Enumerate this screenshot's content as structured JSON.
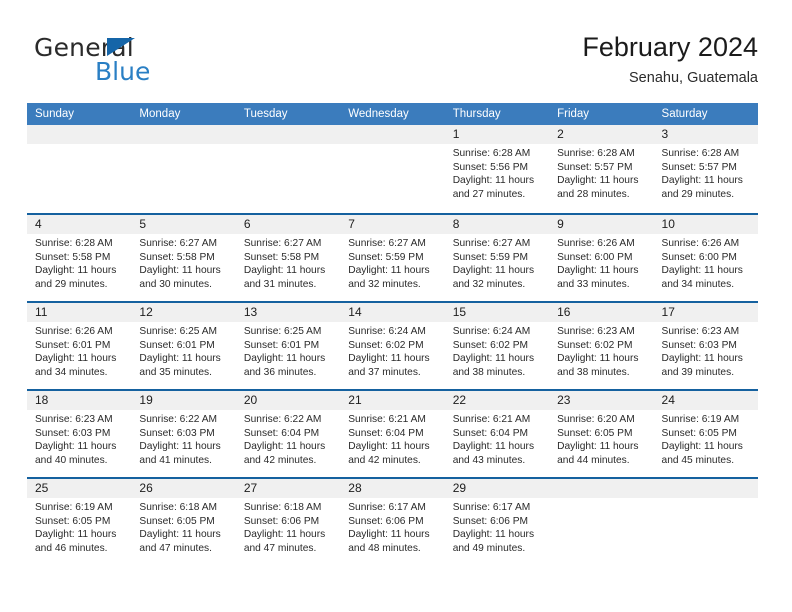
{
  "brand": {
    "name_top": "General",
    "name_bottom": "Blue",
    "triangle_color": "#1565a8",
    "blue_color": "#2a7fc4"
  },
  "header": {
    "title": "February 2024",
    "subtitle": "Senahu, Guatemala"
  },
  "theme": {
    "header_blue": "#3b7cbd",
    "row_line_blue": "#15619f",
    "day_number_band": "#f0f0f0"
  },
  "weekdays": [
    "Sunday",
    "Monday",
    "Tuesday",
    "Wednesday",
    "Thursday",
    "Friday",
    "Saturday"
  ],
  "weeks": [
    [
      {
        "day": "",
        "sunrise": "",
        "sunset": "",
        "daylight": "",
        "empty": true
      },
      {
        "day": "",
        "sunrise": "",
        "sunset": "",
        "daylight": "",
        "empty": true
      },
      {
        "day": "",
        "sunrise": "",
        "sunset": "",
        "daylight": "",
        "empty": true
      },
      {
        "day": "",
        "sunrise": "",
        "sunset": "",
        "daylight": "",
        "empty": true
      },
      {
        "day": "1",
        "sunrise": "Sunrise: 6:28 AM",
        "sunset": "Sunset: 5:56 PM",
        "daylight": "Daylight: 11 hours and 27 minutes."
      },
      {
        "day": "2",
        "sunrise": "Sunrise: 6:28 AM",
        "sunset": "Sunset: 5:57 PM",
        "daylight": "Daylight: 11 hours and 28 minutes."
      },
      {
        "day": "3",
        "sunrise": "Sunrise: 6:28 AM",
        "sunset": "Sunset: 5:57 PM",
        "daylight": "Daylight: 11 hours and 29 minutes."
      }
    ],
    [
      {
        "day": "4",
        "sunrise": "Sunrise: 6:28 AM",
        "sunset": "Sunset: 5:58 PM",
        "daylight": "Daylight: 11 hours and 29 minutes."
      },
      {
        "day": "5",
        "sunrise": "Sunrise: 6:27 AM",
        "sunset": "Sunset: 5:58 PM",
        "daylight": "Daylight: 11 hours and 30 minutes."
      },
      {
        "day": "6",
        "sunrise": "Sunrise: 6:27 AM",
        "sunset": "Sunset: 5:58 PM",
        "daylight": "Daylight: 11 hours and 31 minutes."
      },
      {
        "day": "7",
        "sunrise": "Sunrise: 6:27 AM",
        "sunset": "Sunset: 5:59 PM",
        "daylight": "Daylight: 11 hours and 32 minutes."
      },
      {
        "day": "8",
        "sunrise": "Sunrise: 6:27 AM",
        "sunset": "Sunset: 5:59 PM",
        "daylight": "Daylight: 11 hours and 32 minutes."
      },
      {
        "day": "9",
        "sunrise": "Sunrise: 6:26 AM",
        "sunset": "Sunset: 6:00 PM",
        "daylight": "Daylight: 11 hours and 33 minutes."
      },
      {
        "day": "10",
        "sunrise": "Sunrise: 6:26 AM",
        "sunset": "Sunset: 6:00 PM",
        "daylight": "Daylight: 11 hours and 34 minutes."
      }
    ],
    [
      {
        "day": "11",
        "sunrise": "Sunrise: 6:26 AM",
        "sunset": "Sunset: 6:01 PM",
        "daylight": "Daylight: 11 hours and 34 minutes."
      },
      {
        "day": "12",
        "sunrise": "Sunrise: 6:25 AM",
        "sunset": "Sunset: 6:01 PM",
        "daylight": "Daylight: 11 hours and 35 minutes."
      },
      {
        "day": "13",
        "sunrise": "Sunrise: 6:25 AM",
        "sunset": "Sunset: 6:01 PM",
        "daylight": "Daylight: 11 hours and 36 minutes."
      },
      {
        "day": "14",
        "sunrise": "Sunrise: 6:24 AM",
        "sunset": "Sunset: 6:02 PM",
        "daylight": "Daylight: 11 hours and 37 minutes."
      },
      {
        "day": "15",
        "sunrise": "Sunrise: 6:24 AM",
        "sunset": "Sunset: 6:02 PM",
        "daylight": "Daylight: 11 hours and 38 minutes."
      },
      {
        "day": "16",
        "sunrise": "Sunrise: 6:23 AM",
        "sunset": "Sunset: 6:02 PM",
        "daylight": "Daylight: 11 hours and 38 minutes."
      },
      {
        "day": "17",
        "sunrise": "Sunrise: 6:23 AM",
        "sunset": "Sunset: 6:03 PM",
        "daylight": "Daylight: 11 hours and 39 minutes."
      }
    ],
    [
      {
        "day": "18",
        "sunrise": "Sunrise: 6:23 AM",
        "sunset": "Sunset: 6:03 PM",
        "daylight": "Daylight: 11 hours and 40 minutes."
      },
      {
        "day": "19",
        "sunrise": "Sunrise: 6:22 AM",
        "sunset": "Sunset: 6:03 PM",
        "daylight": "Daylight: 11 hours and 41 minutes."
      },
      {
        "day": "20",
        "sunrise": "Sunrise: 6:22 AM",
        "sunset": "Sunset: 6:04 PM",
        "daylight": "Daylight: 11 hours and 42 minutes."
      },
      {
        "day": "21",
        "sunrise": "Sunrise: 6:21 AM",
        "sunset": "Sunset: 6:04 PM",
        "daylight": "Daylight: 11 hours and 42 minutes."
      },
      {
        "day": "22",
        "sunrise": "Sunrise: 6:21 AM",
        "sunset": "Sunset: 6:04 PM",
        "daylight": "Daylight: 11 hours and 43 minutes."
      },
      {
        "day": "23",
        "sunrise": "Sunrise: 6:20 AM",
        "sunset": "Sunset: 6:05 PM",
        "daylight": "Daylight: 11 hours and 44 minutes."
      },
      {
        "day": "24",
        "sunrise": "Sunrise: 6:19 AM",
        "sunset": "Sunset: 6:05 PM",
        "daylight": "Daylight: 11 hours and 45 minutes."
      }
    ],
    [
      {
        "day": "25",
        "sunrise": "Sunrise: 6:19 AM",
        "sunset": "Sunset: 6:05 PM",
        "daylight": "Daylight: 11 hours and 46 minutes."
      },
      {
        "day": "26",
        "sunrise": "Sunrise: 6:18 AM",
        "sunset": "Sunset: 6:05 PM",
        "daylight": "Daylight: 11 hours and 47 minutes."
      },
      {
        "day": "27",
        "sunrise": "Sunrise: 6:18 AM",
        "sunset": "Sunset: 6:06 PM",
        "daylight": "Daylight: 11 hours and 47 minutes."
      },
      {
        "day": "28",
        "sunrise": "Sunrise: 6:17 AM",
        "sunset": "Sunset: 6:06 PM",
        "daylight": "Daylight: 11 hours and 48 minutes."
      },
      {
        "day": "29",
        "sunrise": "Sunrise: 6:17 AM",
        "sunset": "Sunset: 6:06 PM",
        "daylight": "Daylight: 11 hours and 49 minutes."
      },
      {
        "day": "",
        "sunrise": "",
        "sunset": "",
        "daylight": "",
        "empty": true
      },
      {
        "day": "",
        "sunrise": "",
        "sunset": "",
        "daylight": "",
        "empty": true
      }
    ]
  ]
}
